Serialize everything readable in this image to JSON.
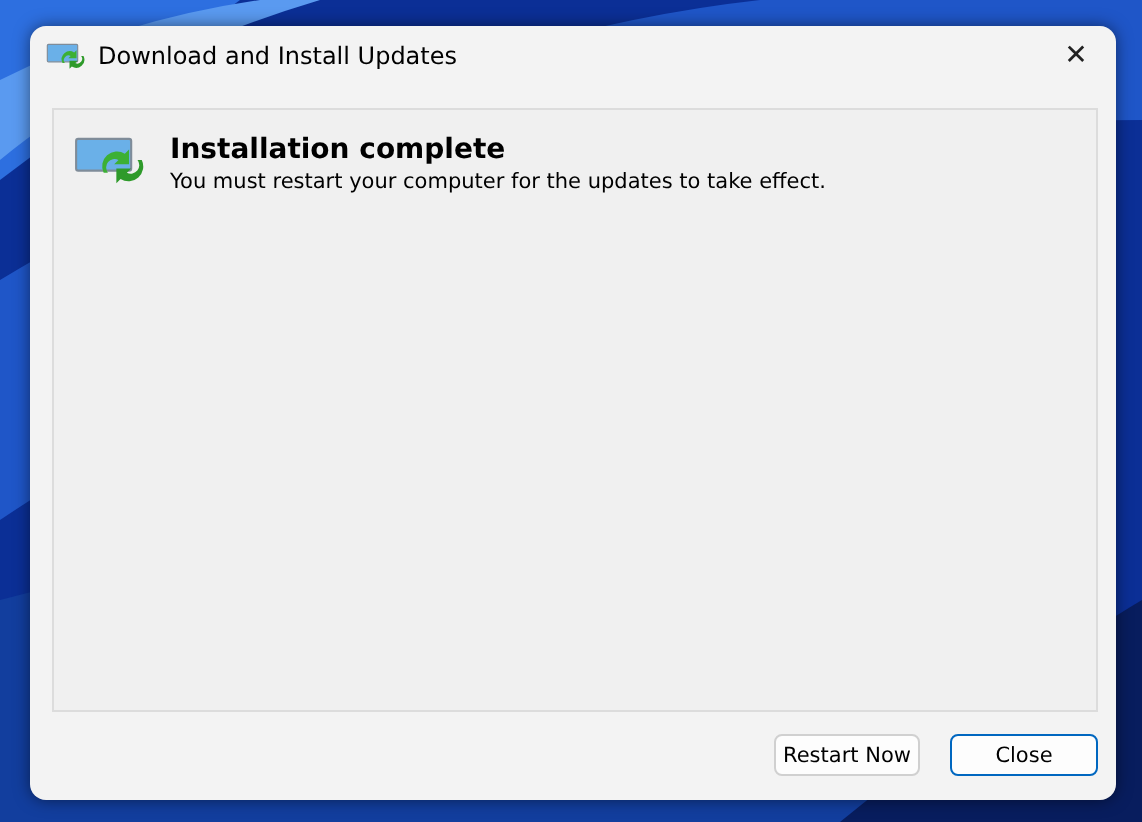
{
  "window": {
    "title": "Download and Install Updates",
    "close": "✕"
  },
  "message": {
    "heading": "Installation complete",
    "text": "You must restart your computer for the updates to take effect."
  },
  "buttons": [
    {
      "label": "Restart Now",
      "default": false
    },
    {
      "label": "Close",
      "default": true
    }
  ]
}
